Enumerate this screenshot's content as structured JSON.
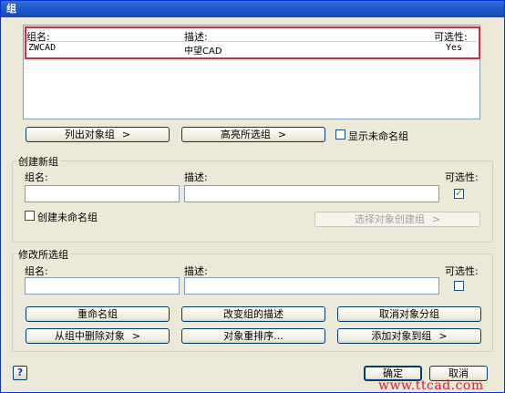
{
  "window": {
    "title": "组"
  },
  "group_list": {
    "headers": {
      "name": "组名:",
      "description": "描述:",
      "selectable": "可选性:"
    },
    "rows": [
      {
        "name": "ZWCAD",
        "description": "中望CAD",
        "selectable": "Yes"
      }
    ]
  },
  "list_actions": {
    "list_objects_label": "列出对象组",
    "highlight_label": "高亮所选组",
    "show_unnamed_label": "显示未命名组",
    "chevron": ">"
  },
  "create_group": {
    "title": "创建新组",
    "name_label": "组名:",
    "description_label": "描述:",
    "selectable_label": "可选性:",
    "selectable_checked": true,
    "unnamed_label": "创建未命名组",
    "select_objects_label": "选择对象创建组",
    "chevron": ">"
  },
  "modify_group": {
    "title": "修改所选组",
    "name_label": "组名:",
    "description_label": "描述:",
    "selectable_label": "可选性:",
    "selectable_checked": false,
    "rename_label": "重命名组",
    "change_description_label": "改变组的描述",
    "ungroup_label": "取消对象分组",
    "remove_label": "从组中删除对象",
    "reorder_label": "对象重排序...",
    "add_label": "添加对象到组",
    "chevron": ">"
  },
  "footer": {
    "help_label": "?",
    "ok_label": "确定",
    "cancel_label": "取消"
  },
  "watermark": "www.ttcad.com"
}
